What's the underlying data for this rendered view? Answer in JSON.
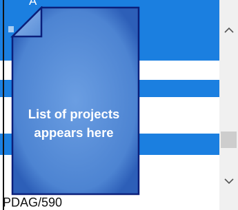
{
  "list": {
    "top_fragment": "A",
    "bottom_fragment": "PDAG/590"
  },
  "placeholder": {
    "label_line1": "List of projects",
    "label_line2": "appears here"
  },
  "scrollbar": {
    "up_icon": "chevron-up-icon",
    "down_icon": "chevron-down-icon"
  },
  "colors": {
    "selection": "#1b7fe0",
    "doc_fill": "#4f86d4",
    "doc_border": "#0b1f7a"
  }
}
